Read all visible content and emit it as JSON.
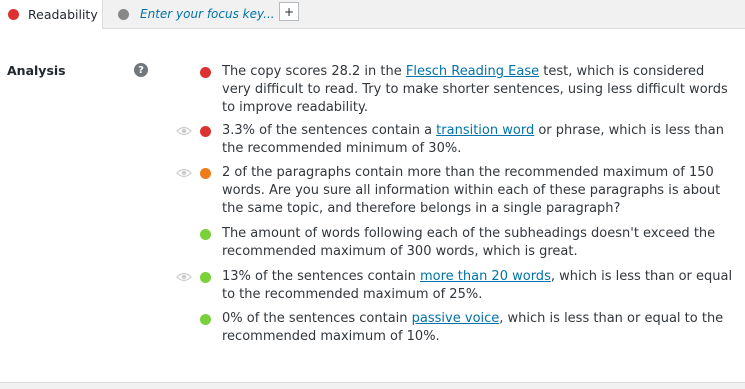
{
  "tabs": {
    "readability": {
      "label": "Readability",
      "status_color": "#dc3232"
    },
    "focus": {
      "placeholder": "Enter your focus key...",
      "status_color": "#888888"
    },
    "add_label": "+"
  },
  "analysis": {
    "heading": "Analysis",
    "help_icon": "?",
    "results": [
      {
        "status": "red",
        "has_eye": false,
        "before": "The copy scores 28.2 in the ",
        "link": "Flesch Reading Ease",
        "after": " test, which is considered very difficult to read. Try to make shorter sentences, using less difficult words to improve readability."
      },
      {
        "status": "red",
        "has_eye": true,
        "before": "3.3% of the sentences contain a ",
        "link": "transition word",
        "after": " or phrase, which is less than the recommended minimum of 30%."
      },
      {
        "status": "orange",
        "has_eye": true,
        "before": "2 of the paragraphs contain more than the recommended maximum of 150 words. Are you sure all information within each of these paragraphs is about the same topic, and therefore belongs in a single paragraph?",
        "link": "",
        "after": ""
      },
      {
        "status": "green",
        "has_eye": false,
        "before": "The amount of words following each of the subheadings doesn't exceed the recommended maximum of 300 words, which is great.",
        "link": "",
        "after": ""
      },
      {
        "status": "green",
        "has_eye": true,
        "before": "13% of the sentences contain ",
        "link": "more than 20 words",
        "after": ", which is less than or equal to the recommended maximum of 25%."
      },
      {
        "status": "green",
        "has_eye": false,
        "before": "0% of the sentences contain ",
        "link": "passive voice",
        "after": ", which is less than or equal to the recommended maximum of 10%."
      }
    ]
  }
}
